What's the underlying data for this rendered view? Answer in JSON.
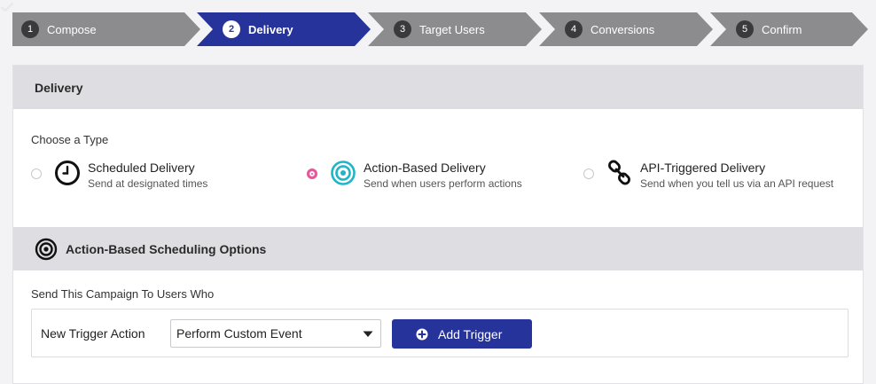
{
  "stepper": {
    "steps": [
      {
        "number": "1",
        "label": "Compose",
        "state": "completed"
      },
      {
        "number": "2",
        "label": "Delivery",
        "state": "active"
      },
      {
        "number": "3",
        "label": "Target Users",
        "state": "upcoming"
      },
      {
        "number": "4",
        "label": "Conversions",
        "state": "upcoming"
      },
      {
        "number": "5",
        "label": "Confirm",
        "state": "upcoming"
      }
    ],
    "colors": {
      "inactive": "#8c8c8f",
      "active": "#26339a"
    }
  },
  "delivery": {
    "title": "Delivery",
    "choose_label": "Choose a Type",
    "options": [
      {
        "title": "Scheduled Delivery",
        "description": "Send at designated times",
        "icon": "clock-icon",
        "selected": false
      },
      {
        "title": "Action-Based Delivery",
        "description": "Send when users perform actions",
        "icon": "target-icon",
        "selected": true
      },
      {
        "title": "API-Triggered Delivery",
        "description": "Send when you tell us via an API request",
        "icon": "chain-link-icon",
        "selected": false
      }
    ]
  },
  "scheduling": {
    "title": "Action-Based Scheduling Options",
    "send_label": "Send This Campaign To Users Who",
    "trigger_label": "New Trigger Action",
    "selected_action": "Perform Custom Event",
    "add_button_label": "Add Trigger"
  },
  "colors": {
    "accent": "#26339a",
    "radio_selected": "#e8559a",
    "target_icon": "#1fb5c7"
  }
}
